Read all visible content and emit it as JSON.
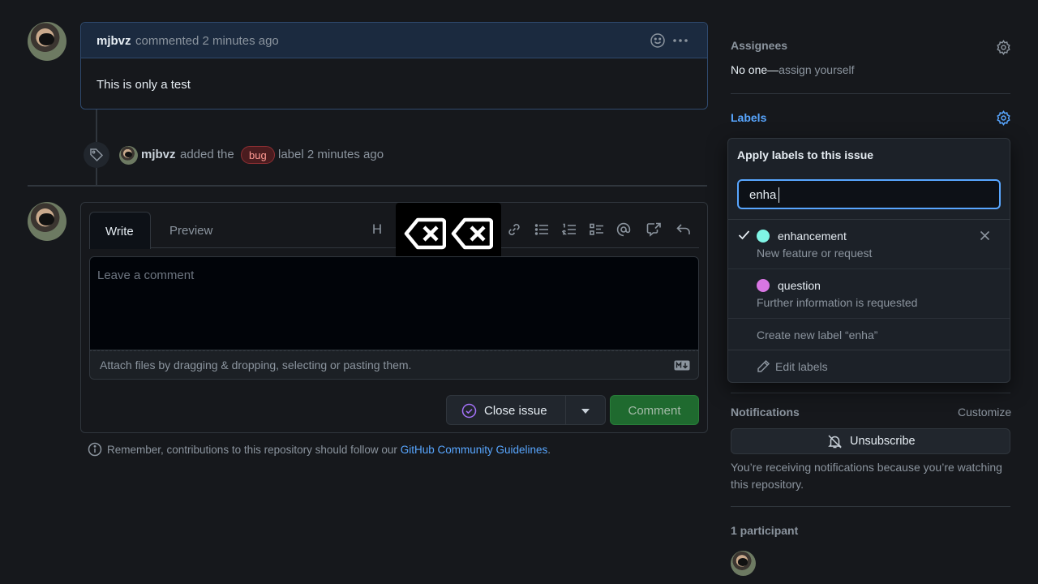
{
  "comment": {
    "author": "mjbvz",
    "action": "commented 2 minutes ago",
    "body": "This is only a test"
  },
  "label_event": {
    "author": "mjbvz",
    "action": "added the",
    "label": "bug",
    "suffix": "label 2 minutes ago"
  },
  "editor": {
    "tabs": [
      "Write",
      "Preview"
    ],
    "heading_icon": "H",
    "placeholder": "Leave a comment",
    "attach_hint": "Attach files by dragging & dropping, selecting or pasting them.",
    "close_issue": "Close issue",
    "comment_button": "Comment",
    "reminder": "Remember, contributions to this repository should follow our",
    "guidelines_link": "GitHub Community Guidelines",
    "guidelines_period": "."
  },
  "sidebar": {
    "assignees": {
      "title": "Assignees",
      "value_prefix": "No one—",
      "value_link": "assign yourself"
    },
    "labels": {
      "title": "Labels"
    },
    "labels_popup": {
      "title": "Apply labels to this issue",
      "filter_value": "enha",
      "options": [
        {
          "name": "enhancement",
          "description": "New feature or request",
          "color": "#7ff4e5",
          "selected": true
        },
        {
          "name": "question",
          "description": "Further information is requested",
          "color": "#d876e3",
          "selected": false
        }
      ],
      "create_label": "Create new label “enha”",
      "edit_labels": "Edit labels"
    },
    "notifications": {
      "title": "Notifications",
      "customize": "Customize",
      "unsubscribe": "Unsubscribe",
      "reason": "You’re receiving notifications because you’re watching this repository."
    },
    "participants": {
      "title": "1 participant"
    }
  },
  "colors": {
    "accent_link": "#58a6ff",
    "comment_green": "#238636",
    "bug_label": "#f85149"
  }
}
